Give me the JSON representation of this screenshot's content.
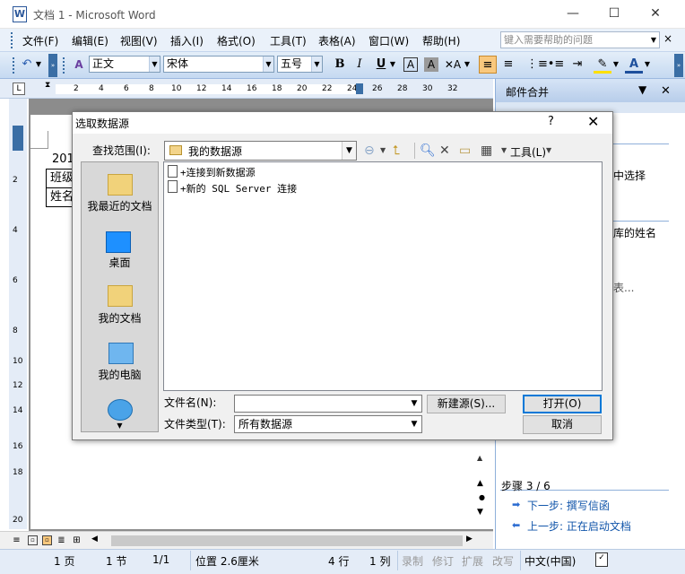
{
  "window": {
    "title": "文档 1 - Microsoft Word",
    "app_icon_letter": "W",
    "controls": {
      "minimize": "—",
      "maximize": "☐",
      "close": "✕"
    }
  },
  "menubar": {
    "items": [
      "文件(F)",
      "编辑(E)",
      "视图(V)",
      "插入(I)",
      "格式(O)",
      "工具(T)",
      "表格(A)",
      "窗口(W)",
      "帮助(H)"
    ],
    "help_placeholder": "键入需要帮助的问题",
    "close": "×"
  },
  "toolbar": {
    "style": "正文",
    "font": "宋体",
    "size": "五号",
    "bold": "B",
    "italic": "I",
    "underline": "U",
    "font_color_label": "A"
  },
  "ruler": {
    "ticks": [
      "2",
      "4",
      "6",
      "8",
      "10",
      "12",
      "14",
      "16",
      "18",
      "20",
      "22",
      "24",
      "26",
      "28",
      "30",
      "32"
    ],
    "vticks": [
      "2",
      "4",
      "6",
      "8",
      "10",
      "12",
      "14",
      "16",
      "18",
      "20"
    ]
  },
  "document": {
    "line1": "201",
    "cell1": "班级",
    "cell2": "姓名"
  },
  "statusbar": {
    "page": "1 页",
    "section": "1 节",
    "pages": "1/1",
    "position": "位置 2.6厘米",
    "line": "4 行",
    "column": "1 列",
    "rec": "录制",
    "trk": "修订",
    "ext": "扩展",
    "ovr": "改写",
    "language": "中文(中国)"
  },
  "taskpane": {
    "title": "邮件合并",
    "text1": "中选择",
    "text2": "库的姓名",
    "text3": "表...",
    "step": "步骤 3 / 6",
    "next": "下一步: 撰写信函",
    "prev": "上一步: 正在启动文档"
  },
  "dialog": {
    "title": "选取数据源",
    "help": "?",
    "close": "✕",
    "lookin_label": "查找范围(I):",
    "lookin_value": "我的数据源",
    "tools_label": "工具(L)",
    "places": [
      "我最近的文档",
      "桌面",
      "我的文档",
      "我的电脑"
    ],
    "files": [
      "+连接到新数据源",
      "+新的 SQL Server 连接"
    ],
    "filename_label": "文件名(N):",
    "filename_value": "",
    "filetype_label": "文件类型(T):",
    "filetype_value": "所有数据源",
    "new_source_button": "新建源(S)...",
    "open_button": "打开(O)",
    "cancel_button": "取消"
  },
  "colors": {
    "toolbar_bg": "#e4eef9",
    "accent": "#0078d7",
    "highlight_button": "#f9c87d"
  }
}
